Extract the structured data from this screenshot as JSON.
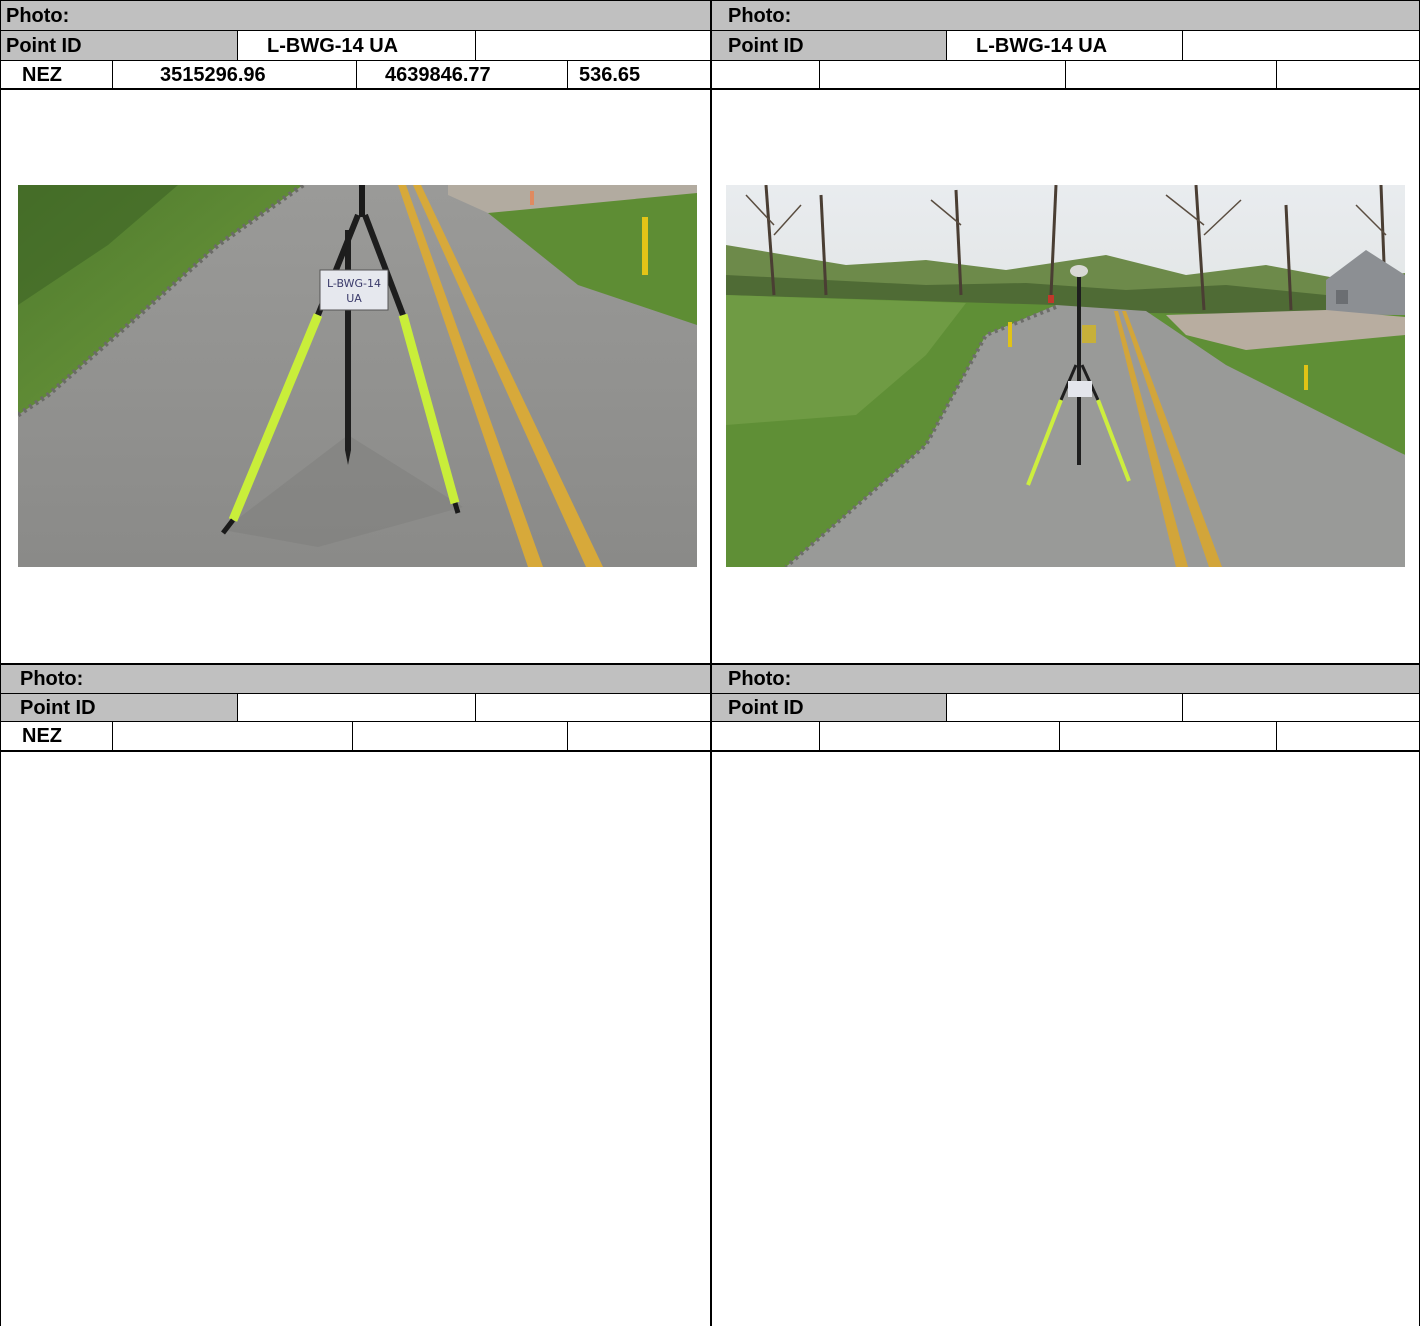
{
  "panels": [
    {
      "photo_label": "Photo:",
      "point_id_label": "Point ID",
      "point_id_value": "L-BWG-14 UA",
      "nez_label": "NEZ",
      "northing": "3515296.96",
      "easting": "4639846.77",
      "elevation": "536.65",
      "image": {
        "subject": "survey tripod with GPS rod on asphalt road, sign reading L-BWG-14 UA",
        "sign_text": "L-BWG-14\nUA"
      }
    },
    {
      "photo_label": "Photo:",
      "point_id_label": "Point ID",
      "point_id_value": "L-BWG-14 UA",
      "image": {
        "subject": "distant view of survey tripod on road with trees and house",
        "sign_text": ""
      }
    },
    {
      "photo_label": "Photo:",
      "point_id_label": "Point ID",
      "nez_label": "NEZ"
    },
    {
      "photo_label": "Photo:",
      "point_id_label": "Point ID"
    }
  ],
  "colors": {
    "header_gray": "#c0c0c0",
    "grid_line": "#000000"
  }
}
